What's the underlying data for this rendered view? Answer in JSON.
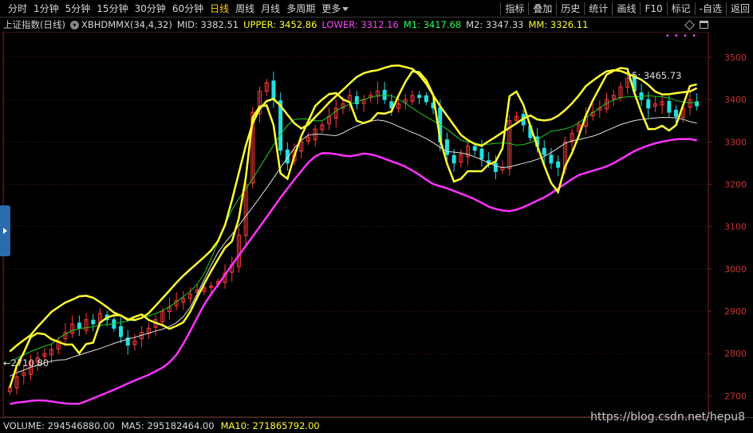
{
  "toolbar": {
    "periods": [
      "分时",
      "1分钟",
      "5分钟",
      "15分钟",
      "30分钟",
      "60分钟",
      "日线",
      "周线",
      "月线",
      "多周期",
      "更多"
    ],
    "active_period": "日线",
    "right_items": [
      "指标",
      "叠加",
      "历史",
      "统计",
      "画线",
      "F10",
      "标记",
      "-自选",
      "返回"
    ]
  },
  "info": {
    "title": "上证指数(日线)",
    "indicator": "XBHDMMX(34,4,32)",
    "mid": "MID: 3382.51",
    "upper": "UPPER: 3452.86",
    "lower": "LOWER: 3312.16",
    "m1": "M1: 3417.68",
    "m2": "M2: 3347.33",
    "mm": "MM: 3326.11"
  },
  "price_axis": {
    "ticks": [
      "3500",
      "3400",
      "3300",
      "3200",
      "3100",
      "3000",
      "2900",
      "2800",
      "2700"
    ]
  },
  "annotations": {
    "max_label": "5: 3465.73",
    "min_label": "←2710.80"
  },
  "volume": {
    "volume": "VOLUME: 294546880.00",
    "ma5": "MA5: 295182464.00",
    "ma10": "MA10: 271865792.00"
  },
  "watermark": "https://blog.csdn.net/hepu8",
  "colors": {
    "up": "#ff3b3b",
    "down": "#22e0e0",
    "upper_band": "#ffff33",
    "lower_band": "#ff33ff",
    "mid": "#e0e0e0",
    "m1": "#22cc22",
    "background": "#000000"
  },
  "chart_data": {
    "type": "candlestick",
    "ylim": [
      2650,
      3560
    ],
    "candles_close": [
      2720,
      2745,
      2755,
      2780,
      2790,
      2800,
      2810,
      2830,
      2850,
      2870,
      2860,
      2880,
      2870,
      2895,
      2880,
      2860,
      2840,
      2820,
      2830,
      2850,
      2860,
      2880,
      2900,
      2910,
      2925,
      2930,
      2940,
      2950,
      2955,
      2960,
      2970,
      2990,
      3010,
      3080,
      3200,
      3370,
      3420,
      3440,
      3400,
      3280,
      3250,
      3280,
      3300,
      3310,
      3330,
      3340,
      3360,
      3380,
      3390,
      3410,
      3390,
      3400,
      3410,
      3420,
      3400,
      3380,
      3390,
      3400,
      3410,
      3405,
      3395,
      3380,
      3300,
      3270,
      3250,
      3270,
      3290,
      3280,
      3260,
      3250,
      3230,
      3240,
      3350,
      3360,
      3340,
      3310,
      3290,
      3270,
      3250,
      3240,
      3300,
      3320,
      3340,
      3360,
      3370,
      3380,
      3400,
      3410,
      3430,
      3450,
      3420,
      3400,
      3380,
      3390,
      3395,
      3370,
      3360,
      3380,
      3400,
      3385
    ]
  }
}
